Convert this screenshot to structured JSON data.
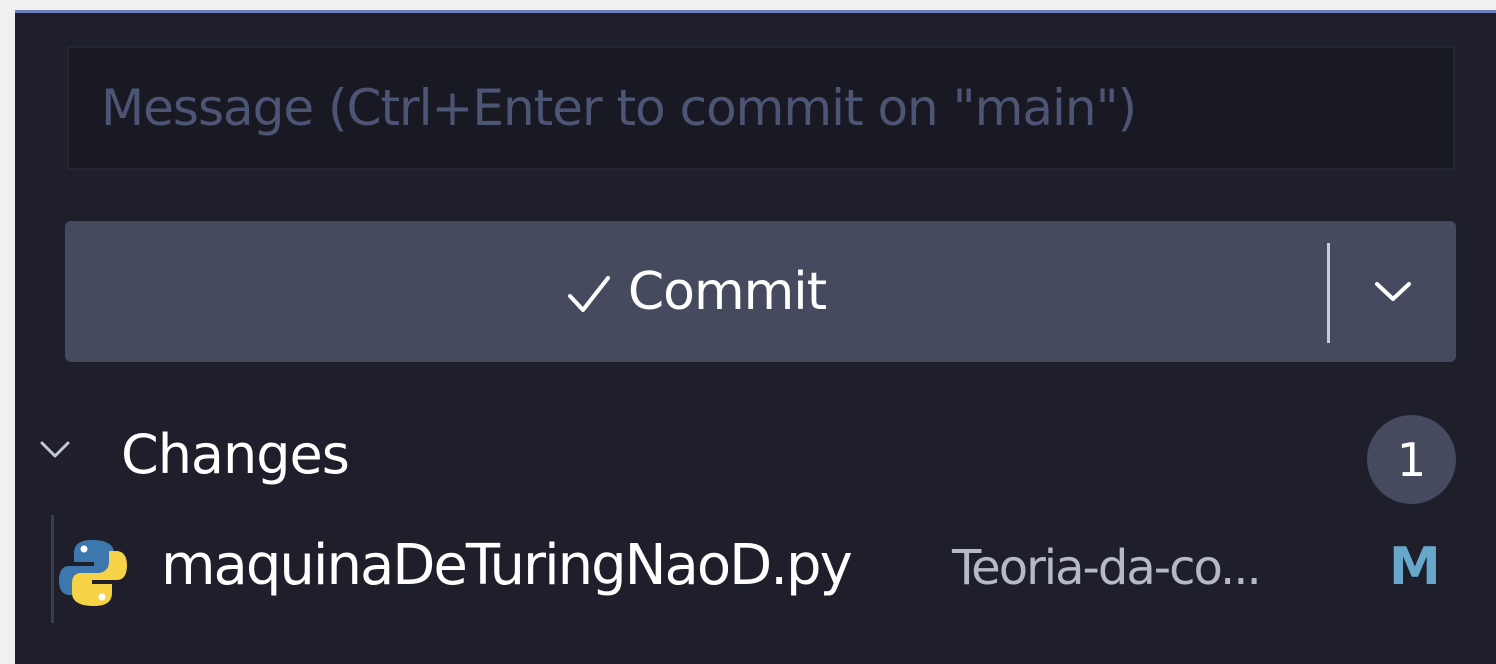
{
  "commit_box": {
    "placeholder": "Message (Ctrl+Enter to commit on \"main\")"
  },
  "commit_button": {
    "label": "Commit",
    "icon": "check-icon",
    "dropdown_icon": "chevron-down-icon"
  },
  "changes": {
    "label": "Changes",
    "count": "1",
    "files": [
      {
        "name": "maquinaDeTuringNaoD.py",
        "path": "Teoria-da-co...",
        "status": "M",
        "icon": "python-file-icon"
      }
    ]
  },
  "colors": {
    "panel_background": "#1e1f2a",
    "button_background": "#454a5f",
    "accent_border": "#6f7db8",
    "modified_status": "#67a7c9"
  }
}
